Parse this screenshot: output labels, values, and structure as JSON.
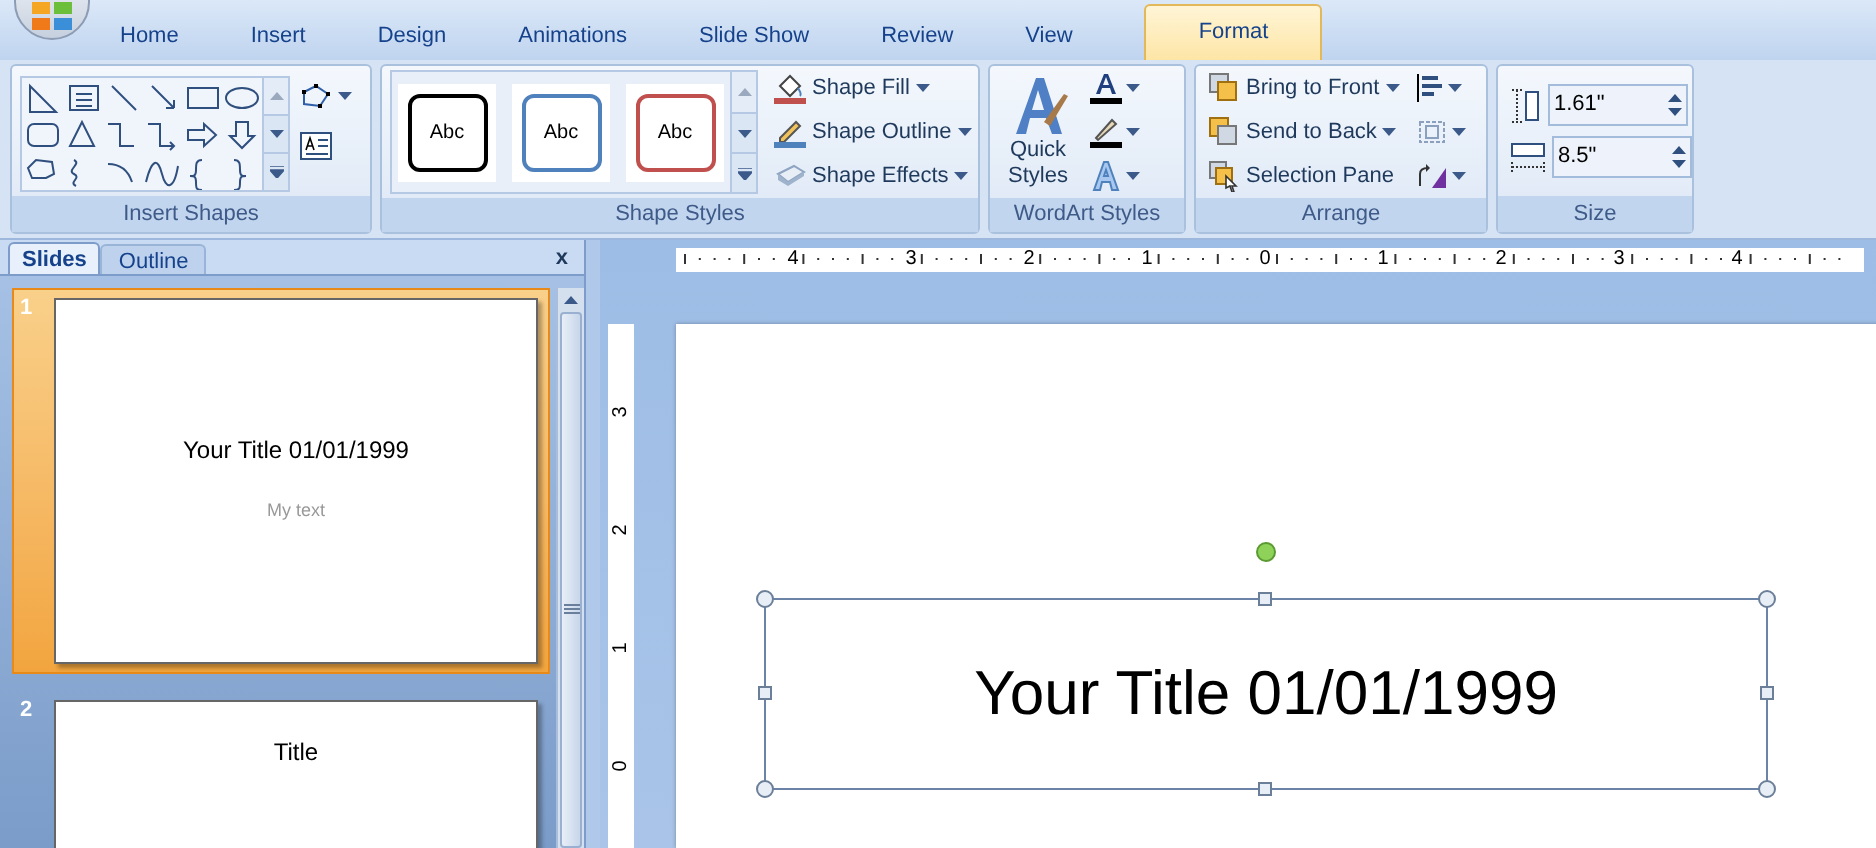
{
  "tabs": [
    {
      "label": "Home",
      "selected": false
    },
    {
      "label": "Insert",
      "selected": false
    },
    {
      "label": "Design",
      "selected": false
    },
    {
      "label": "Animations",
      "selected": false
    },
    {
      "label": "Slide Show",
      "selected": false
    },
    {
      "label": "Review",
      "selected": false
    },
    {
      "label": "View",
      "selected": false
    },
    {
      "label": "Format",
      "selected": true
    }
  ],
  "ribbon": {
    "insert_shapes": {
      "label": "Insert Shapes"
    },
    "shape_styles": {
      "label": "Shape Styles",
      "swatches": [
        {
          "text": "Abc",
          "color": "#000000"
        },
        {
          "text": "Abc",
          "color": "#4f81bd"
        },
        {
          "text": "Abc",
          "color": "#c0504d"
        }
      ],
      "commands": [
        "Shape Fill",
        "Shape Outline",
        "Shape Effects"
      ]
    },
    "wordart_styles": {
      "label": "WordArt Styles",
      "quick_styles": "Quick Styles"
    },
    "arrange": {
      "label": "Arrange",
      "commands": [
        "Bring to Front",
        "Send to Back",
        "Selection Pane"
      ]
    },
    "size": {
      "label": "Size",
      "height": "1.61\"",
      "width": "8.5\""
    }
  },
  "slides_pane": {
    "tabs": [
      {
        "label": "Slides",
        "selected": true
      },
      {
        "label": "Outline",
        "selected": false
      }
    ],
    "close": "x",
    "slides": [
      {
        "number": "1",
        "selected": true,
        "title": "Your Title 01/01/1999",
        "subtitle": "My text"
      },
      {
        "number": "2",
        "selected": false,
        "title": "Title"
      }
    ]
  },
  "rulers": {
    "horizontal": [
      "4",
      "3",
      "2",
      "1",
      "0",
      "1",
      "2",
      "3",
      "4"
    ],
    "vertical": [
      "3",
      "2",
      "1",
      "0"
    ]
  },
  "slide": {
    "title": "Your Title 01/01/1999",
    "selected": true
  }
}
